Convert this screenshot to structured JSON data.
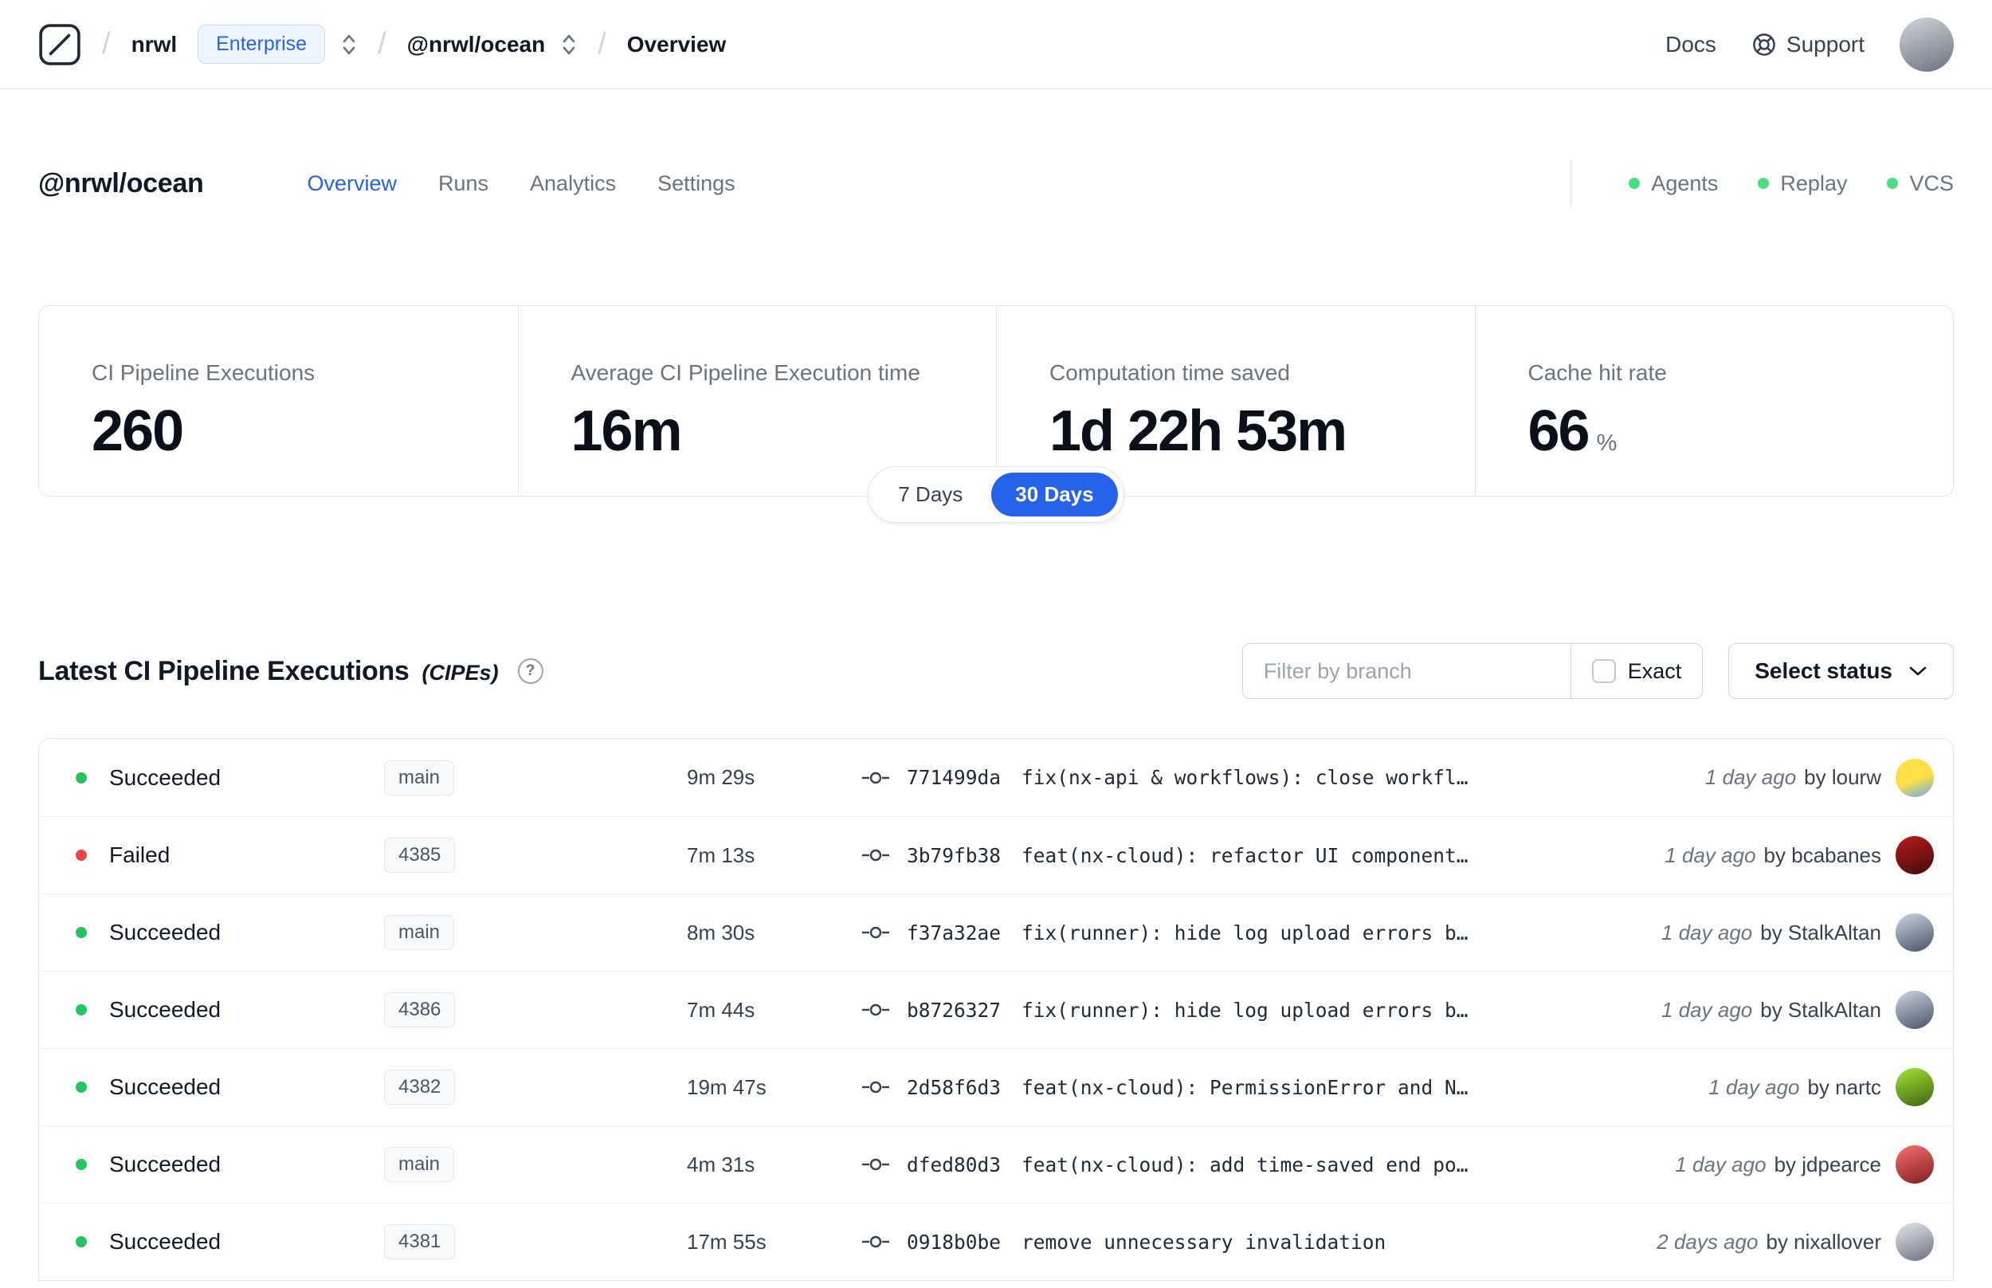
{
  "topbar": {
    "breadcrumb": {
      "separator": "/",
      "org": "nrwl",
      "org_badge": "Enterprise",
      "workspace": "@nrwl/ocean",
      "page": "Overview"
    },
    "docs_label": "Docs",
    "support_label": "Support"
  },
  "workspace": {
    "title": "@nrwl/ocean",
    "tabs": [
      {
        "label": "Overview"
      },
      {
        "label": "Runs"
      },
      {
        "label": "Analytics"
      },
      {
        "label": "Settings"
      }
    ],
    "active_tab": "Overview",
    "indicators": [
      {
        "label": "Agents"
      },
      {
        "label": "Replay"
      },
      {
        "label": "VCS"
      }
    ]
  },
  "metrics": {
    "cards": [
      {
        "label": "CI Pipeline Executions",
        "value": "260"
      },
      {
        "label": "Average CI Pipeline Execution time",
        "value": "16m"
      },
      {
        "label": "Computation time saved",
        "value": "1d 22h 53m"
      },
      {
        "label": "Cache hit rate",
        "value": "66",
        "unit": "%"
      }
    ],
    "range_toggle": {
      "options": [
        {
          "label": "7 Days"
        },
        {
          "label": "30 Days"
        }
      ],
      "selected": "30 Days"
    }
  },
  "cipe": {
    "title": "Latest CI Pipeline Executions",
    "subtitle": "(CIPEs)",
    "help_glyph": "?",
    "filter": {
      "placeholder": "Filter by branch",
      "exact_label": "Exact",
      "status_button_label": "Select status"
    },
    "rows": [
      {
        "status": "Succeeded",
        "status_dot_css": "background:#22c55e",
        "branch": "main",
        "duration": "9m 29s",
        "commit_hash": "771499da",
        "commit_message": "fix(nx-api & workflows): close workfl…",
        "time": "1 day ago",
        "author": "by lourw",
        "avatar_css": "background:linear-gradient(160deg,#fde047 55%,#60a5fa 100%)"
      },
      {
        "status": "Failed",
        "status_dot_css": "background:#ef4444",
        "branch": "4385",
        "duration": "7m 13s",
        "commit_hash": "3b79fb38",
        "commit_message": "feat(nx-cloud): refactor UI component…",
        "time": "1 day ago",
        "author": "by bcabanes",
        "avatar_css": "background:linear-gradient(160deg,#b91c1c,#450a0a)"
      },
      {
        "status": "Succeeded",
        "status_dot_css": "background:#22c55e",
        "branch": "main",
        "duration": "8m 30s",
        "commit_hash": "f37a32ae",
        "commit_message": "fix(runner): hide log upload errors b…",
        "time": "1 day ago",
        "author": "by StalkAltan",
        "avatar_css": "background:linear-gradient(160deg,#cbd5e1,#475569)"
      },
      {
        "status": "Succeeded",
        "status_dot_css": "background:#22c55e",
        "branch": "4386",
        "duration": "7m 44s",
        "commit_hash": "b8726327",
        "commit_message": "fix(runner): hide log upload errors b…",
        "time": "1 day ago",
        "author": "by StalkAltan",
        "avatar_css": "background:linear-gradient(160deg,#cbd5e1,#475569)"
      },
      {
        "status": "Succeeded",
        "status_dot_css": "background:#22c55e",
        "branch": "4382",
        "duration": "19m 47s",
        "commit_hash": "2d58f6d3",
        "commit_message": "feat(nx-cloud): PermissionError and N…",
        "time": "1 day ago",
        "author": "by nartc",
        "avatar_css": "background:linear-gradient(160deg,#a3e635,#3f6212)"
      },
      {
        "status": "Succeeded",
        "status_dot_css": "background:#22c55e",
        "branch": "main",
        "duration": "4m 31s",
        "commit_hash": "dfed80d3",
        "commit_message": "feat(nx-cloud): add time-saved end po…",
        "time": "1 day ago",
        "author": "by jdpearce",
        "avatar_css": "background:linear-gradient(160deg,#f87171,#7f1d1d)"
      },
      {
        "status": "Succeeded",
        "status_dot_css": "background:#22c55e",
        "branch": "4381",
        "duration": "17m 55s",
        "commit_hash": "0918b0be",
        "commit_message": "remove unnecessary invalidation",
        "time": "2 days ago",
        "author": "by nixallover",
        "avatar_css": "background:linear-gradient(160deg,#e5e7eb,#6b7280)"
      }
    ]
  },
  "colors": {
    "accent_blue": "#2563eb",
    "success_green": "#22c55e",
    "failure_red": "#ef4444",
    "border_gray": "#e5e7eb"
  }
}
